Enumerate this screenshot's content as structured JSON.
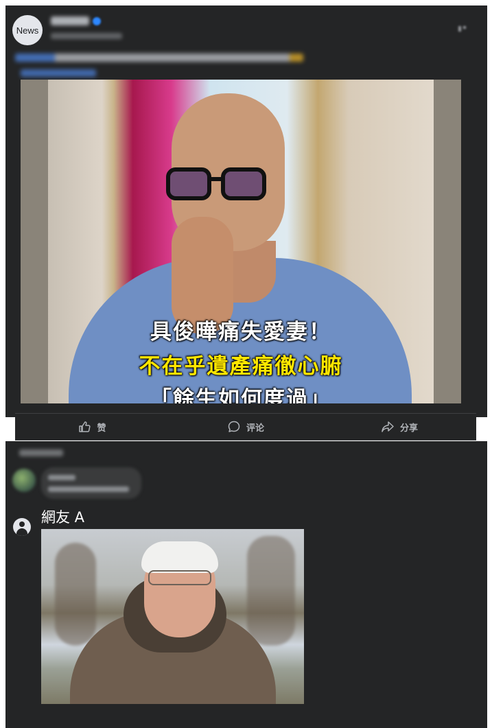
{
  "post": {
    "avatar_label": "News",
    "image_headline": {
      "line1": "具俊曄痛失愛妻！",
      "line2": "不在乎遺產痛徹心腑",
      "line3": "「餘生如何度過」"
    }
  },
  "actions": {
    "like": "赞",
    "comment": "评论",
    "share": "分享"
  },
  "comment": {
    "author": "網友 A"
  },
  "icons": {
    "like": "thumbs-up-icon",
    "comment": "speech-bubble-icon",
    "share": "share-arrow-icon",
    "more": "more-horizontal-icon",
    "user": "user-avatar-icon",
    "verified": "verified-badge-icon"
  },
  "colors": {
    "card_background": "#242526",
    "headline_yellow": "#ffe600",
    "verified_blue": "#2d88ff"
  }
}
